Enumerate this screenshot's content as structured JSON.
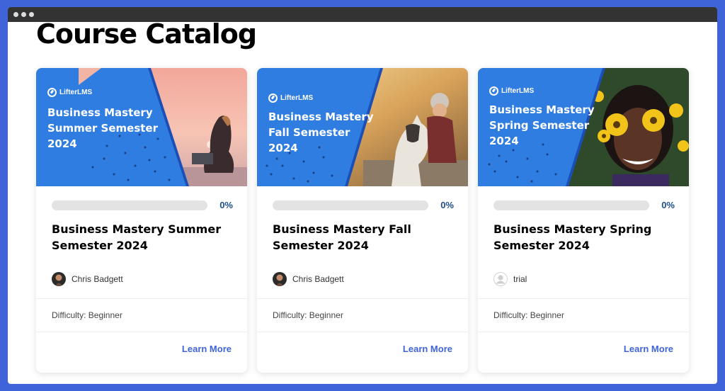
{
  "page": {
    "title": "Course Catalog"
  },
  "courses": [
    {
      "brand": "LifterLMS",
      "banner_title": "Business Mastery Summer Semester 2024",
      "progress": 0,
      "progress_label": "0%",
      "title": "Business Mastery Summer Semester 2024",
      "author": "Chris Badgett",
      "difficulty": "Difficulty: Beginner",
      "cta": "Learn More"
    },
    {
      "brand": "LifterLMS",
      "banner_title": "Business Mastery Fall Semester 2024",
      "progress": 0,
      "progress_label": "0%",
      "title": "Business Mastery Fall Semester 2024",
      "author": "Chris Badgett",
      "difficulty": "Difficulty: Beginner",
      "cta": "Learn More"
    },
    {
      "brand": "LifterLMS",
      "banner_title": "Business Mastery Spring Semester 2024",
      "progress": 0,
      "progress_label": "0%",
      "title": "Business Mastery Spring Semester 2024",
      "author": "trial",
      "difficulty": "Difficulty: Beginner",
      "cta": "Learn More"
    }
  ],
  "colors": {
    "accent": "#3f63d8",
    "banner_blue": "#2f7de0",
    "percent": "#1f4e8c"
  }
}
